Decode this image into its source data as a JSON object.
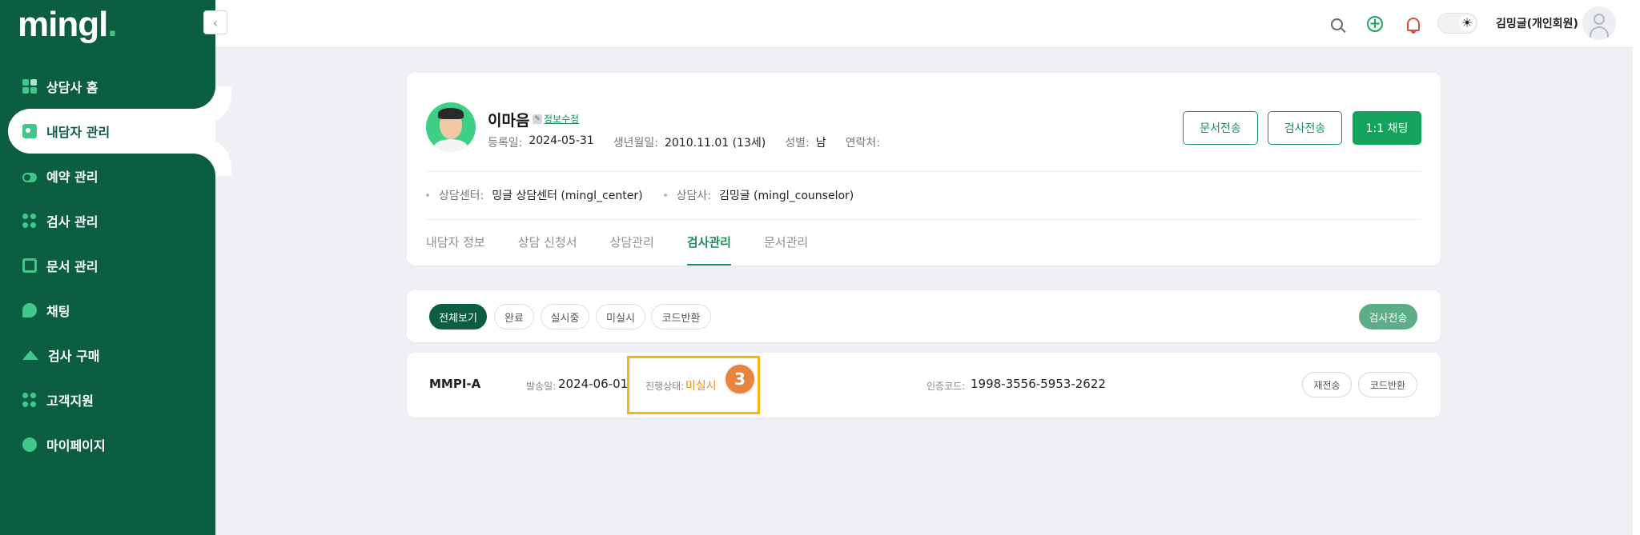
{
  "app": {
    "logo_text": "mingl",
    "logo_dot": "."
  },
  "sidebar": {
    "collapse_glyph": "‹",
    "items": [
      {
        "label": "상담사 홈",
        "icon": "dashboard-icon"
      },
      {
        "label": "내담자 관리",
        "icon": "client-card-icon"
      },
      {
        "label": "예약 관리",
        "icon": "reservation-toggle-icon"
      },
      {
        "label": "검사 관리",
        "icon": "test-dots-icon"
      },
      {
        "label": "문서 관리",
        "icon": "document-icon"
      },
      {
        "label": "채팅",
        "icon": "chat-icon"
      },
      {
        "label": "검사 구매",
        "icon": "graduation-cap-icon"
      },
      {
        "label": "고객지원",
        "icon": "support-icon"
      },
      {
        "label": "마이페이지",
        "icon": "user-icon"
      }
    ],
    "active_index": 1
  },
  "topbar": {
    "user_name": "김밍글(개인회원)",
    "theme_glyph": "☀",
    "plus_glyph": "+"
  },
  "profile": {
    "name": "이마음",
    "edit_glyph": "✎",
    "edit_link": "정보수정",
    "registered_label": "등록일:",
    "registered_value": "2024-05-31",
    "birth_label": "생년월일:",
    "birth_value": "2010.11.01 (13세)",
    "gender_label": "성별:",
    "gender_value": "남",
    "contact_label": "연락처:",
    "contact_value": "",
    "center_label": "상담센터:",
    "center_value": "밍글 상담센터 (mingl_center)",
    "counselor_label": "상담사:",
    "counselor_value": "김밍글 (mingl_counselor)",
    "buttons": {
      "send_document": "문서전송",
      "send_test": "검사전송",
      "chat": "1:1 채팅"
    },
    "tabs": [
      "내담자 정보",
      "상담 신청서",
      "상담관리",
      "검사관리",
      "문서관리"
    ],
    "active_tab": 3
  },
  "filters": {
    "chips": [
      "전체보기",
      "완료",
      "실시중",
      "미실시",
      "코드반환"
    ],
    "active": 0,
    "send_button": "검사전송"
  },
  "test_row": {
    "name": "MMPI-A",
    "sent_label": "발송일:",
    "sent_value": "2024-06-01",
    "status_label": "진행상태:",
    "status_value": "미실시",
    "step_badge": "3",
    "auth_label": "인증코드:",
    "auth_value": "1998-3556-5953-2622",
    "resend_button": "재전송",
    "code_return_button": "코드반환"
  },
  "colors": {
    "sidebar_bg": "#0b5e42",
    "accent_green": "#14a35c",
    "status_orange": "#f08a1c",
    "highlight_yellow": "#f5b70f",
    "badge_orange": "#e7853f"
  }
}
